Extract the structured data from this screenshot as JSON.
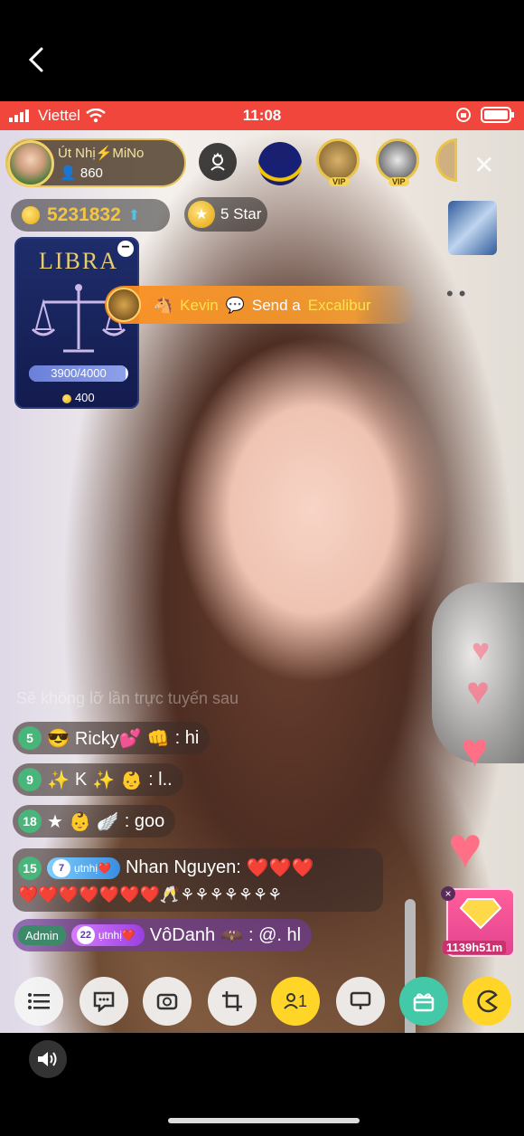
{
  "status_bar": {
    "carrier": "Viettel",
    "time": "11:08"
  },
  "host": {
    "name": "Út Nhị⚡MiNo",
    "fans": "860"
  },
  "wallet": {
    "coins": "5231832",
    "star_label": "5 Star"
  },
  "libra": {
    "title": "LIBRA",
    "progress_text": "3900/4000",
    "progress": 0.975,
    "coins": "400"
  },
  "gift_banner": {
    "user": "Kevin",
    "action": "Send a",
    "gift": "Excalibur"
  },
  "overlay_hint": "Sẽ không lỡ lần trực tuyến sau",
  "chat": [
    {
      "level": "5",
      "prefix": "😎",
      "name": "Ricky💕",
      "suffix": "👊",
      "message": ": hi"
    },
    {
      "level": "9",
      "prefix": "✨",
      "name": "K",
      "suffix": "✨",
      "message": ": l.."
    },
    {
      "level": "18",
      "prefix": "★",
      "name": "",
      "suffix": "",
      "message": ": goo"
    },
    {
      "level": "15",
      "badge_num": "7",
      "badge_label": "ụtnhị❤️",
      "name": "Nhan Nguyen:",
      "message": "❤️❤️❤️"
    },
    {
      "line2": "❤️❤️❤️❤️❤️❤️❤️🥂⚘⚘⚘⚘⚘⚘⚘"
    },
    {
      "admin_label": "Admin",
      "badge_num": "22",
      "badge_label": "ụtnhị❤️",
      "name": "VôDanh",
      "message": ": @. hl"
    }
  ],
  "promo": {
    "timer": "1139h51m"
  },
  "toolbar": {
    "viewers": "1"
  },
  "colors": {
    "status_red": "#f0463c",
    "gift_orange": "#fa8c1e",
    "toolbar_yellow": "#ffd628",
    "toolbar_teal": "#43c9a8"
  }
}
